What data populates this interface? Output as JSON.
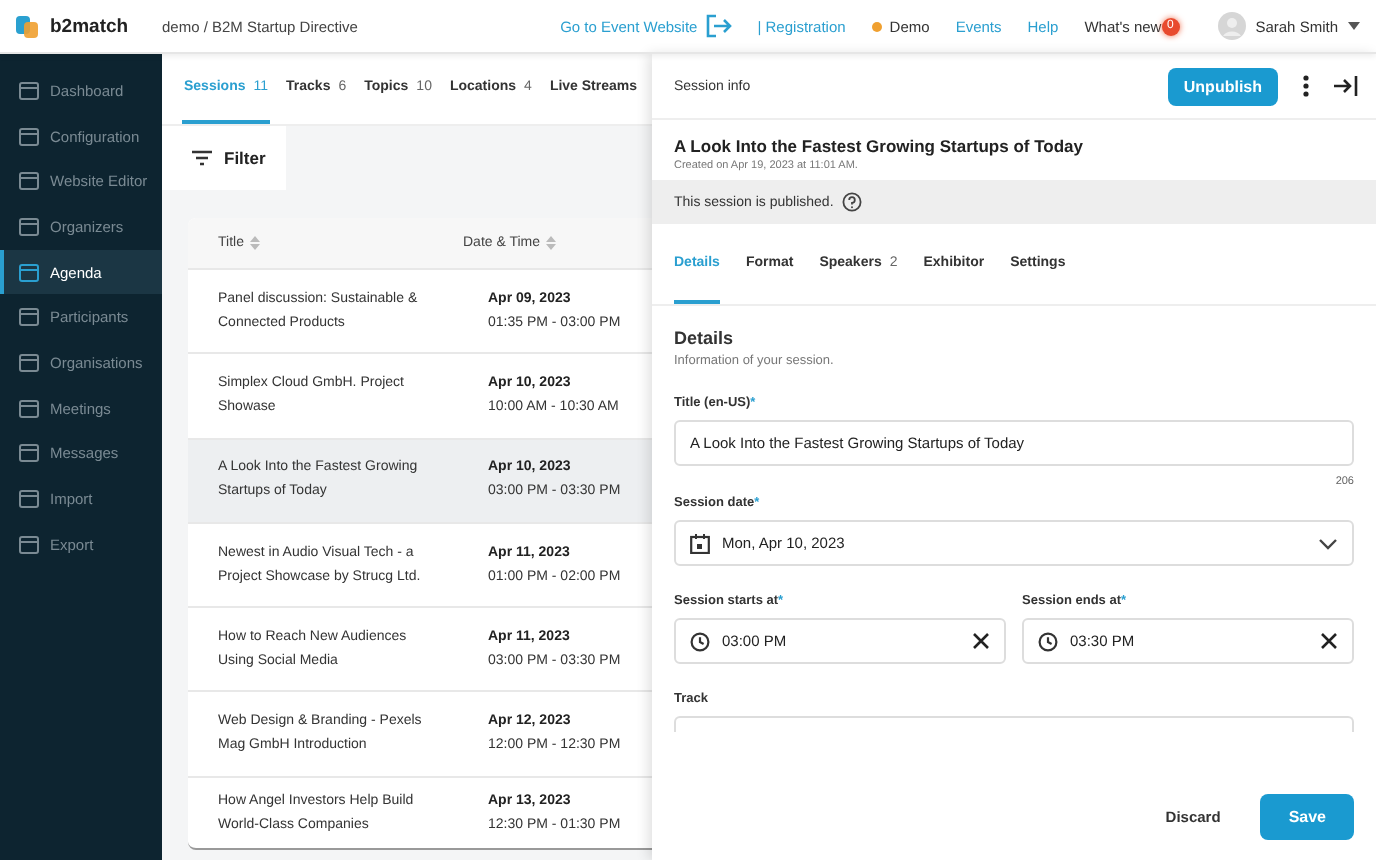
{
  "header": {
    "brand": "b2match",
    "breadcrumb": "demo / B2M Startup Directive",
    "links": [
      {
        "label": "Go to Event Website",
        "kind": "external"
      },
      {
        "label": "| Registration",
        "kind": "plain"
      },
      {
        "label": "Demo",
        "kind": "status",
        "color": "#f0a030"
      },
      {
        "label": "Events",
        "kind": "plain"
      },
      {
        "label": "Help",
        "kind": "plain"
      }
    ],
    "whats_new": {
      "label": "What's new",
      "badge": "0"
    },
    "user": {
      "name": "Sarah Smith"
    }
  },
  "sidebar": {
    "items": [
      {
        "label": "Dashboard",
        "selected": false
      },
      {
        "label": "Configuration",
        "selected": false
      },
      {
        "label": "Website Editor",
        "selected": false
      },
      {
        "label": "Organizers",
        "selected": false
      },
      {
        "label": "Agenda",
        "selected": true
      },
      {
        "label": "Participants",
        "selected": false
      },
      {
        "label": "Organisations",
        "selected": false
      },
      {
        "label": "Meetings",
        "selected": false
      },
      {
        "label": "Messages",
        "selected": false
      },
      {
        "label": "Import",
        "selected": false
      },
      {
        "label": "Export",
        "selected": false
      }
    ]
  },
  "tabs": [
    {
      "label": "Sessions",
      "count": "11",
      "selected": true
    },
    {
      "label": "Tracks",
      "count": "6",
      "selected": false
    },
    {
      "label": "Topics",
      "count": "10",
      "selected": false
    },
    {
      "label": "Locations",
      "count": "4",
      "selected": false
    },
    {
      "label": "Live Streams",
      "selected": false
    }
  ],
  "filter": {
    "label": "Filter"
  },
  "table": {
    "columns": [
      "Title",
      "Date & Time"
    ],
    "rows": [
      {
        "title": "Panel discussion: Sustainable & Connected Products",
        "date": "Apr 09, 2023",
        "time": "01:35 PM - 03:00 PM",
        "selected": false
      },
      {
        "title": "Simplex Cloud GmbH. Project Showase",
        "date": "Apr 10, 2023",
        "time": "10:00 AM - 10:30 AM",
        "selected": false
      },
      {
        "title": "A Look Into the Fastest Growing Startups of Today",
        "date": "Apr 10, 2023",
        "time": "03:00 PM - 03:30 PM",
        "selected": true
      },
      {
        "title": "Newest in Audio Visual Tech - a Project Showcase by Strucg Ltd.",
        "date": "Apr 11, 2023",
        "time": "01:00 PM - 02:00 PM",
        "selected": false
      },
      {
        "title": "How to Reach New Audiences Using Social Media",
        "date": "Apr 11, 2023",
        "time": "03:00 PM - 03:30 PM",
        "selected": false
      },
      {
        "title": "Web Design & Branding - Pexels Mag GmbH Introduction",
        "date": "Apr 12, 2023",
        "time": "12:00 PM - 12:30 PM",
        "selected": false
      },
      {
        "title": "How Angel Investors Help Build World-Class Companies",
        "date": "Apr 13, 2023",
        "time": "12:30 PM - 01:30 PM",
        "selected": false
      }
    ]
  },
  "panel": {
    "heading": "Session info",
    "unpublish": "Unpublish",
    "title": "A Look Into the Fastest Growing Startups of Today",
    "created": "Created on Apr 19, 2023 at 11:01 AM.",
    "notice": "This session is published.",
    "tabs": [
      {
        "label": "Details",
        "selected": true
      },
      {
        "label": "Format",
        "selected": false
      },
      {
        "label": "Speakers",
        "count": "2",
        "selected": false
      },
      {
        "label": "Exhibitor",
        "selected": false
      },
      {
        "label": "Settings",
        "selected": false
      }
    ],
    "section_title": "Details",
    "section_hint": "Information of your session.",
    "fields": [
      {
        "kind": "text",
        "label": "Title (en-US)",
        "required_mark": "*",
        "value": "A Look Into the Fastest Growing Startups of Today",
        "counter": "206"
      },
      {
        "kind": "date",
        "label": "Session date",
        "required_mark": "*",
        "value": "Mon, Apr 10, 2023"
      },
      {
        "kind": "time_pair",
        "items": [
          {
            "label": "Session starts at",
            "required_mark": "*",
            "value": "03:00 PM"
          },
          {
            "label": "Session ends at",
            "required_mark": "*",
            "value": "03:30 PM"
          }
        ]
      },
      {
        "kind": "select",
        "label": "Track"
      }
    ],
    "discard": "Discard",
    "save": "Save"
  }
}
